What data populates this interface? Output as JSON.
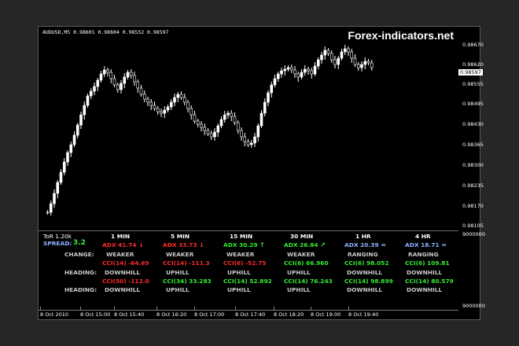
{
  "chart": {
    "symbol_line": "AUDUSD,M5  0.98601 0.98604 0.98552 0.98597",
    "watermark": "Forex-indicators.net",
    "price_ticks": [
      "0.98670",
      "0.98620",
      "0.98555",
      "0.98495",
      "0.98430",
      "0.98365",
      "0.98300",
      "0.98235",
      "0.98170",
      "0.98105"
    ],
    "last_price": "0.98597",
    "indicator_ticks": [
      "9000000",
      "9000000"
    ],
    "time_ticks": [
      "8 Oct 2010",
      "8 Oct 15:00",
      "8 Oct 15:40",
      "8 Oct 16:20",
      "8 Oct 17:00",
      "8 Oct 17:40",
      "8 Oct 18:20",
      "8 Oct 19:00",
      "8 Oct 19:40"
    ],
    "colors": {
      "bull": "#ffffff",
      "bear": "#000000",
      "background": "#000000"
    }
  },
  "panel": {
    "tor": "ToR 1.20k",
    "spread_label": "SPREAD:",
    "spread_value": "3.2",
    "change_label": "CHANGE:",
    "heading_label": "HEADING:",
    "heading_label2": "HEADING:",
    "timeframes": [
      {
        "name": "1 MIN",
        "adx": "ADX 41.74",
        "adx_color": "r",
        "arrow": "↓",
        "state": "WEAKER",
        "cci1": "CCI(14) -64.69",
        "cci1_color": "r",
        "h1": "DOWNHILL",
        "cci2": "CCI(50) -112.0",
        "cci2_color": "r",
        "h2": "DOWNHILL"
      },
      {
        "name": "5 MIN",
        "adx": "ADX 33.73",
        "adx_color": "r",
        "arrow": "↓",
        "state": "WEAKER",
        "cci1": "CCI(14) -111.3",
        "cci1_color": "r",
        "h1": "UPHILL",
        "cci2": "CCI(34) 33.283",
        "cci2_color": "g",
        "h2": "UPHILL"
      },
      {
        "name": "15 MIN",
        "adx": "ADX 30.29",
        "adx_color": "g",
        "arrow": "↑",
        "state": "WEAKER",
        "cci1": "CCI(6) -52.75",
        "cci1_color": "r",
        "h1": "UPHILL",
        "cci2": "CCI(14) 52.892",
        "cci2_color": "g",
        "h2": "UPHILL"
      },
      {
        "name": "30 MIN",
        "adx": "ADX 26.84",
        "adx_color": "g",
        "arrow": "↗",
        "state": "WEAKER",
        "cci1": "CCI(6) 66.960",
        "cci1_color": "g",
        "h1": "UPHILL",
        "cci2": "CCI(14) 76.243",
        "cci2_color": "g",
        "h2": "UPHILL"
      },
      {
        "name": "1 HR",
        "adx": "ADX 20.39",
        "adx_color": "b",
        "arrow": "≈",
        "state": "RANGING",
        "cci1": "CCI(6) 98.052",
        "cci1_color": "g",
        "h1": "DOWNHILL",
        "cci2": "CCI(14) 98.899",
        "cci2_color": "g",
        "h2": "DOWNHILL"
      },
      {
        "name": "4 HR",
        "adx": "ADX 18.71",
        "adx_color": "b",
        "arrow": "≈",
        "state": "RANGING",
        "cci1": "CCI(6) 109.81",
        "cci1_color": "g",
        "h1": "DOWNHILL",
        "cci2": "CCI(14) 80.579",
        "cci2_color": "g",
        "h2": "DOWNHILL"
      }
    ]
  }
}
